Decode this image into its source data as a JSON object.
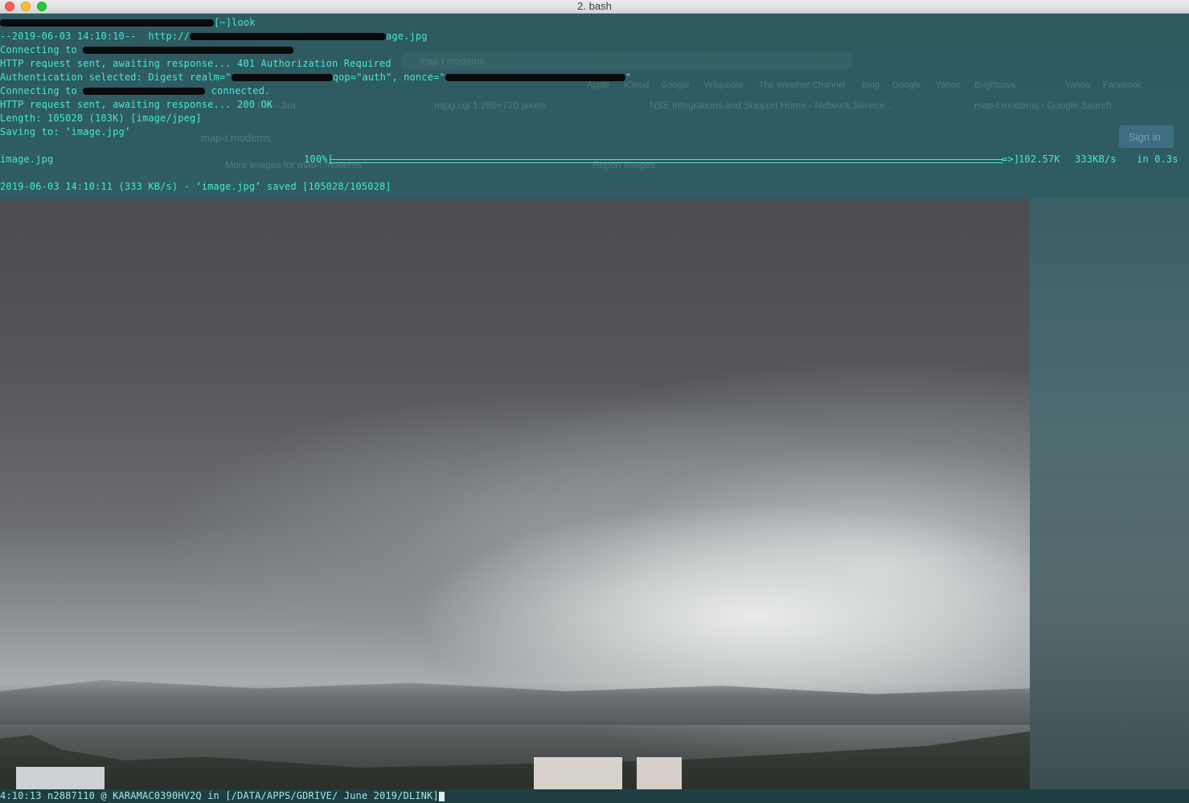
{
  "window": {
    "title": "2. bash"
  },
  "terminal": {
    "lines": [
      "[~]look",
      "--2019-06-03 14:10:10--  http://",
      "age.jpg",
      "Connecting to ",
      "HTTP request sent, awaiting response... 401 Authorization Required",
      "Authentication selected: Digest realm=\"",
      "qop=\"auth\", nonce=\"",
      "\"",
      "Connecting to ",
      " connected.",
      "HTTP request sent, awaiting response... 200 OK",
      "Length: 105028 (103K) [image/jpeg]",
      "Saving to: ‘image.jpg’",
      "2019-06-03 14:10:11 (333 KB/s) - ‘image.jpg’ saved [105028/105028]"
    ],
    "progress": {
      "filename": "image.jpg",
      "percent_label": "100%[",
      "arrow_end": "=>]",
      "size": "102.57K",
      "rate": "333KB/s",
      "time": "in 0.3s",
      "fraction": 1.0
    },
    "prompt": "4:10:13 n2887110 @ KARAMAC0390HV2Q in [/DATA/APPS/GDRIVE/ June 2019/DLINK]"
  },
  "background_browser": {
    "search_text": "map-t modems",
    "sign_in": "Sign in",
    "more_images": "More images for map-t modems",
    "report_images": "Report images",
    "tabs": [
      "PM - Jira",
      "mjpg.cgi 1,280×720 pixels",
      "NSE Integrations and Support Home - Network Service...",
      "map-t modems - Google Search"
    ],
    "bookmarks": [
      "Apple",
      "iCloud",
      "Google",
      "Wikipedia",
      "The Weather Channel",
      "Bing",
      "Google",
      "Yahoo",
      "Brightcove",
      "Yahoo",
      "Facebook"
    ]
  },
  "colors": {
    "terminal_text": "#45e6d2",
    "terminal_bg": "#2e5a60",
    "redaction": "#0a0a0a"
  }
}
